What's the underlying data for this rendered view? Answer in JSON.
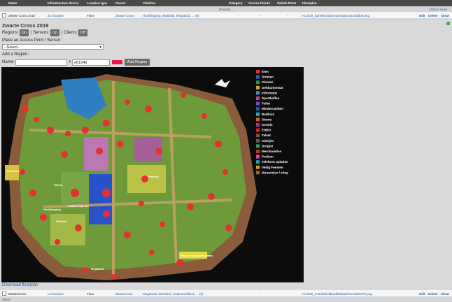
{
  "table": {
    "columns": [
      "Name",
      "Infrastructure device",
      "Location type",
      "Parent",
      "Children",
      "Category",
      "Access Points",
      "Switch Ports",
      "Floorplan"
    ],
    "row1": {
      "name": "Zwarte Cross 2019",
      "device": "ZC-location",
      "type": "Floor",
      "parent": "Zwarte Cross",
      "children": "Hoofdingang, Walhalla, Megaland, ... (9)",
      "category": "-",
      "access_points": "-",
      "switch_ports": "-",
      "floorplan": "FL2019_dat789231464419423a4c2cd5dbaf.png",
      "edit": "Edit",
      "delete": "Delete",
      "show": "Show"
    },
    "parent_note": "(Parent)",
    "click_to_reset": "Click to reset",
    "row2": {
      "name": "ZwarteCross",
      "device": "LO-location",
      "type": "Floor",
      "parent": "Zwartecross",
      "children": "Megaland, Standard, Underworldend, ... (8)",
      "category": "-",
      "access_points": "-",
      "switch_ports": "-",
      "floorplan": "FL2006_2764d3fcd8b4dd8da6d76c4413c675.png",
      "edit": "Edit",
      "delete": "Delete",
      "show": "Show"
    }
  },
  "panel": {
    "title": "Zwarte Cross 2019",
    "regions_label": "Regions:",
    "regions_state": "On",
    "sensors_label": "| Sensors:",
    "sensors_state": "On",
    "clients_label": "| Clients:",
    "clients_state": "Off",
    "place_label": "Place an Access Point / Sensor:",
    "select_value": "--Select--",
    "add_region_label": "Add a Region:",
    "name_label": "Name:",
    "name_value": "",
    "color_hash": "#",
    "color_value": "e6194b",
    "add_region_button": "Add Region",
    "download": "Download floorplan",
    "swatch_color": "#e6194b"
  },
  "map": {
    "legend": [
      "Eten",
      "Drinken",
      "Planten",
      "Geldautomaat",
      "Informatie",
      "Sportkaffee",
      "Toilet",
      "Mindervaliden",
      "Badhuis",
      "Stunts",
      "Kermis",
      "EHBO",
      "Tabak",
      "Kluisjes",
      "Drogist",
      "Merchandise",
      "Podium",
      "Telefoon opladen",
      "Veilig Feesten",
      "Waanmbar / shop"
    ],
    "labels": [
      "Ruilmarkt",
      "Helma",
      "Hoofdingang",
      "Walhalla",
      "Megaland",
      "Zodiac Express",
      "Podium",
      "Bezoekersparkeerplaats"
    ]
  },
  "footer_text": "About"
}
